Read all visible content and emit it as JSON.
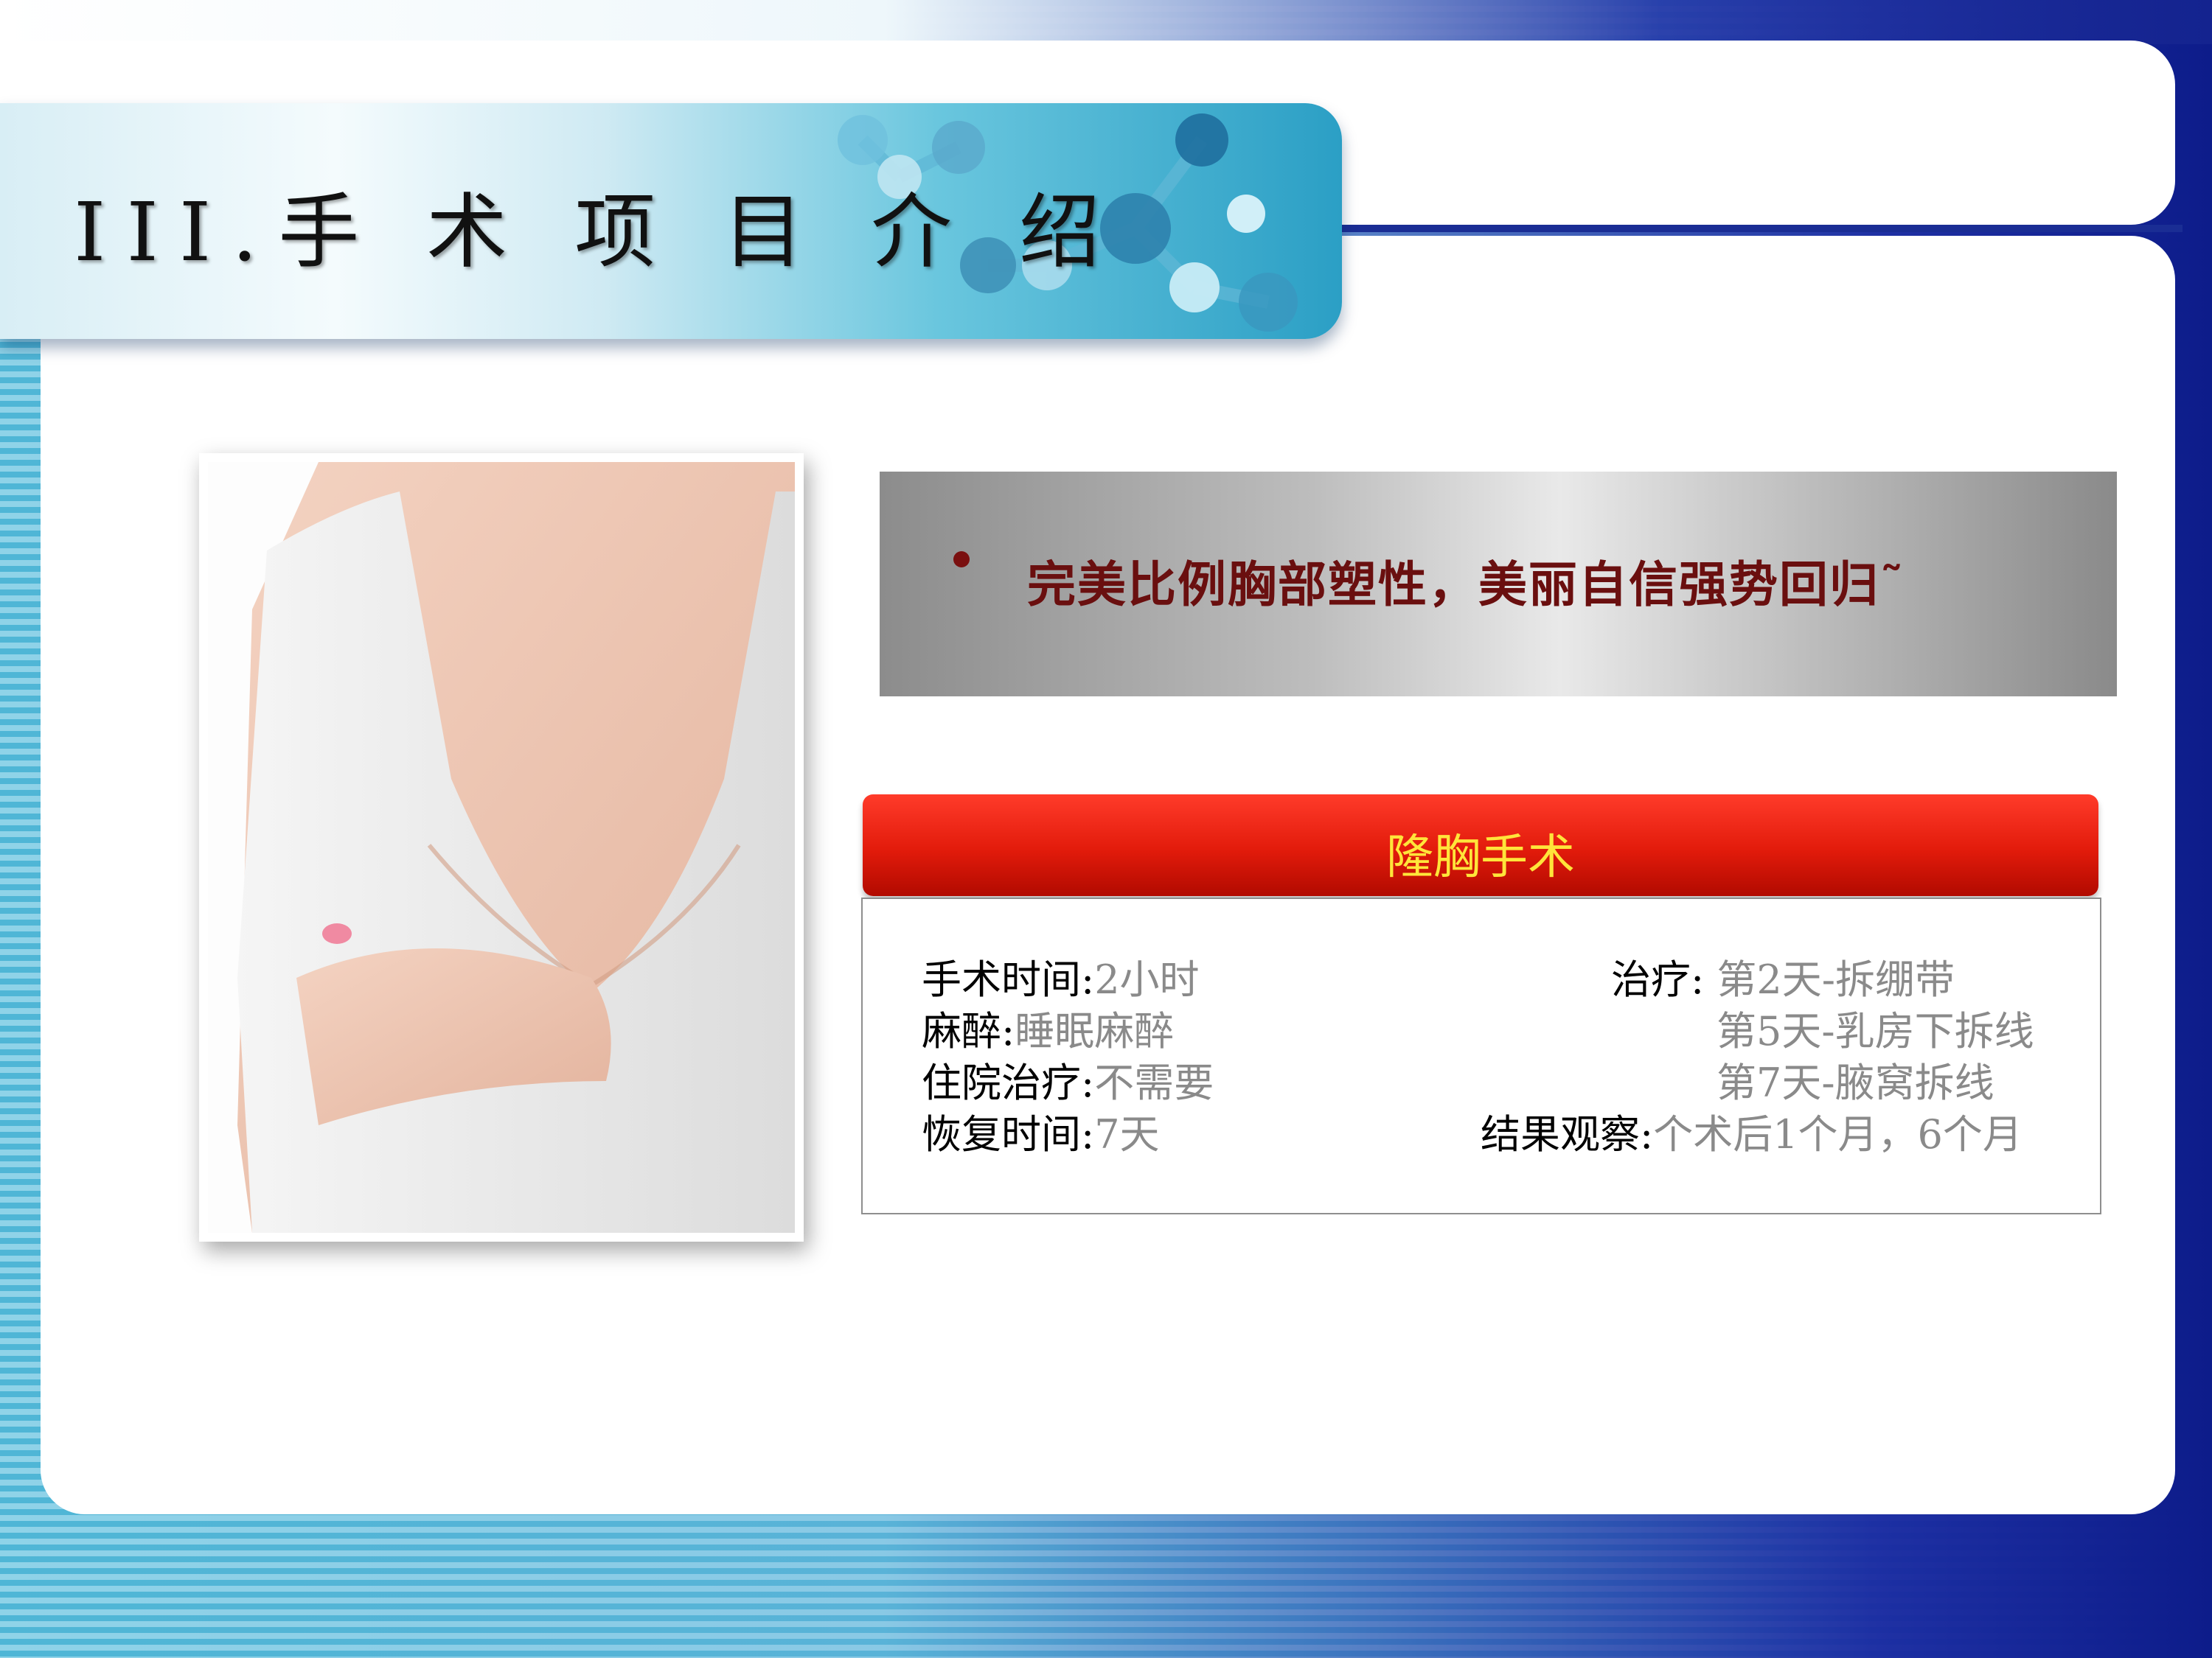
{
  "header": {
    "title": "III.手 术 项 目 介 绍"
  },
  "tagline": {
    "bullet": "•",
    "text": "完美比例胸部塑性，美丽自信强势回归˜"
  },
  "procedure": {
    "name": "隆胸手术",
    "details_left": [
      {
        "label": "手术时间:",
        "value": "2小时"
      },
      {
        "label": "麻醉:",
        "value": "睡眠麻醉"
      },
      {
        "label": "住院治疗:",
        "value": "不需要"
      },
      {
        "label": "恢复时间:",
        "value": "7天"
      }
    ],
    "details_right": [
      {
        "label": "治疗:",
        "value": " 第2天-拆绷带"
      },
      {
        "label": "",
        "value": "第5天-乳房下拆线"
      },
      {
        "label": "",
        "value": "第7天-腋窝拆线"
      },
      {
        "label": "结果观察:",
        "value": "个术后1个月，6个月"
      }
    ]
  },
  "colors": {
    "accent_red": "#e21b0b",
    "heading_yellow": "#ffe53a",
    "tagline_red": "#6a0f0f",
    "navy": "#1a2d94"
  }
}
